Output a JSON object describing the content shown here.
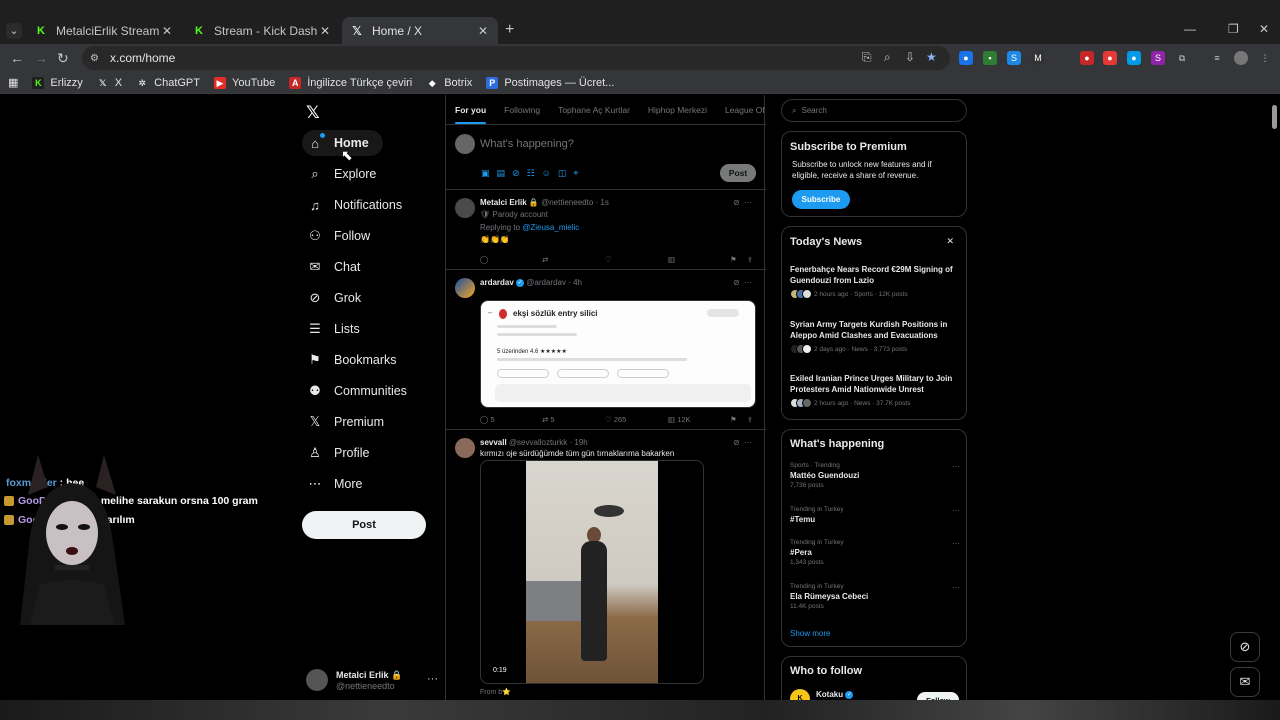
{
  "browser": {
    "tabs": [
      {
        "title": "MetalciErlik Stream - Watch Live",
        "icon": "kick-icon"
      },
      {
        "title": "Stream - Kick Dashboard",
        "icon": "kick-icon"
      },
      {
        "title": "Home / X",
        "icon": "x-icon",
        "active": true
      }
    ],
    "url": "x.com/home",
    "bookmarks": [
      "Erlizzy",
      "X",
      "ChatGPT",
      "YouTube",
      "İngilizce Türkçe çeviri",
      "Botrix",
      "Postimages — Ücret..."
    ]
  },
  "nav": {
    "items": [
      {
        "label": "Home",
        "icon": "home-icon",
        "active": true
      },
      {
        "label": "Explore",
        "icon": "search-icon"
      },
      {
        "label": "Notifications",
        "icon": "bell-icon"
      },
      {
        "label": "Follow",
        "icon": "add-user-icon"
      },
      {
        "label": "Chat",
        "icon": "mail-icon"
      },
      {
        "label": "Grok",
        "icon": "grok-icon"
      },
      {
        "label": "Lists",
        "icon": "list-icon"
      },
      {
        "label": "Bookmarks",
        "icon": "bookmark-icon"
      },
      {
        "label": "Communities",
        "icon": "people-icon"
      },
      {
        "label": "Premium",
        "icon": "x-icon"
      },
      {
        "label": "Profile",
        "icon": "person-icon"
      },
      {
        "label": "More",
        "icon": "more-circle-icon"
      }
    ],
    "post_label": "Post",
    "account": {
      "name": "Metalci Erlik 🔒",
      "handle": "@nettieneedto"
    }
  },
  "feed": {
    "tabs": [
      "For you",
      "Following",
      "Tophane Aç Kurtlar",
      "Hiphop Merkezi",
      "League Of Le"
    ],
    "composer": {
      "placeholder": "What's happening?",
      "post_label": "Post"
    },
    "tweets": [
      {
        "name": "Metalci Erlik 🔒",
        "handle": "@nettieneedto · 1s",
        "line1": "🛡 Parody account",
        "replying": "Replying to ",
        "replying_to": "@Zieusa_mielic",
        "text": "👏👏👏"
      },
      {
        "name": "ardardav",
        "handle": "@ardardav · 4h",
        "card_title": "ekşi sözlük entry silici",
        "card_rating": "5 üzerinden 4.6 ★★★★★",
        "replies": "5",
        "reposts": "5",
        "likes": "265",
        "views": "12K"
      },
      {
        "name": "sevvall",
        "handle": "@sevvallozturkk · 19h",
        "text": "kırmızı oje sürdüğümde tüm gün tırnaklarıma bakarken",
        "video_time": "0:19",
        "from": "From b⭐"
      }
    ]
  },
  "sidebar": {
    "search_placeholder": "Search",
    "premium": {
      "title": "Subscribe to Premium",
      "text": "Subscribe to unlock new features and if eligible, receive a share of revenue.",
      "button": "Subscribe"
    },
    "news": {
      "title": "Today's News",
      "items": [
        {
          "title": "Fenerbahçe Nears Record €29M Signing of Guendouzi from Lazio",
          "meta": "2 hours ago · Sports · 12K posts"
        },
        {
          "title": "Syrian Army Targets Kurdish Positions in Aleppo Amid Clashes and Evacuations",
          "meta": "2 days ago · News · 3,773 posts"
        },
        {
          "title": "Exiled Iranian Prince Urges Military to Join Protesters Amid Nationwide Unrest",
          "meta": "2 hours ago · News · 37.7K posts"
        }
      ]
    },
    "happening": {
      "title": "What's happening",
      "items": [
        {
          "context": "Sports · Trending",
          "topic": "Mattéo Guendouzi",
          "posts": "7,736 posts"
        },
        {
          "context": "Trending in Turkey",
          "topic": "#Temu",
          "posts": ""
        },
        {
          "context": "Trending in Turkey",
          "topic": "#Pera",
          "posts": "1,343 posts"
        },
        {
          "context": "Trending in Turkey",
          "topic": "Ela Rümeysa Cebeci",
          "posts": "11.4K posts"
        }
      ],
      "show_more": "Show more"
    },
    "who_to_follow": {
      "title": "Who to follow",
      "name": "Kotaku",
      "button": "Follow"
    }
  },
  "overlay_chat": [
    {
      "user": "foxmulder",
      "msg": " : hee"
    },
    {
      "user": "GooDByEJoJo",
      "msg": " : melihe sarakun orsna 100 gram"
    },
    {
      "user": "GooDByEJoJo",
      "msg": " : sarılım"
    }
  ],
  "colors": {
    "accent": "#1d9bf0",
    "background": "#000000",
    "kick_green": "#53fc18"
  }
}
